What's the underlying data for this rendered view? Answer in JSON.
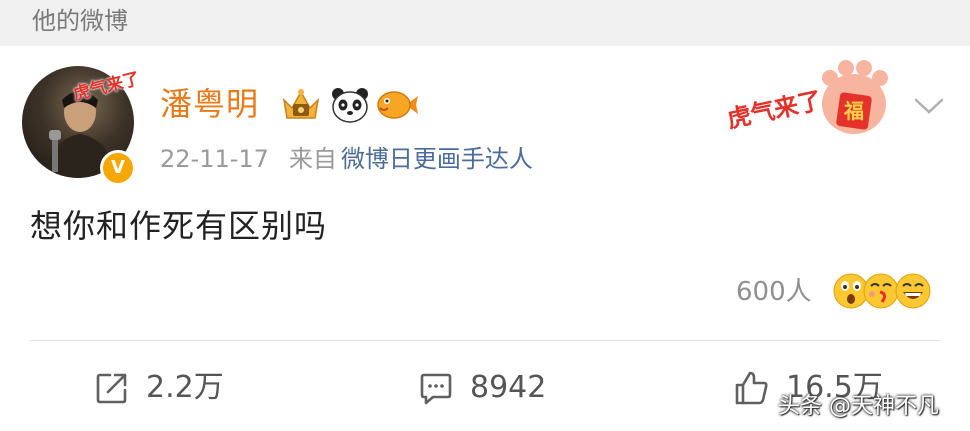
{
  "section": {
    "title": "他的微博"
  },
  "post": {
    "avatar": {
      "overlay_text": "虎气来了",
      "verified_mark": "V"
    },
    "username": "潘粤明",
    "badges": [
      "vip-crown-icon",
      "panda-icon",
      "pufferfish-icon"
    ],
    "date": "22-11-17",
    "from_label": "来自",
    "source": "微博日更画手达人",
    "festival_badge": {
      "text": "虎气来了",
      "stamp": "福"
    },
    "content": "想你和作死有区别吗",
    "reactions": {
      "count_label": "600人",
      "emojis": [
        "surprised-emoji",
        "kiss-emoji",
        "laugh-emoji"
      ]
    },
    "actions": {
      "repost": {
        "icon": "share-icon",
        "count": "2.2万"
      },
      "comment": {
        "icon": "comment-icon",
        "count": "8942"
      },
      "like": {
        "icon": "thumbs-up-icon",
        "count": "16.5万"
      }
    }
  },
  "watermark": "头条 @天神不凡",
  "colors": {
    "username": "#ea7a19",
    "source_link": "#4c6c9a",
    "meta_gray": "#9a9a9a",
    "header_bg": "#f0f0f0",
    "festival_red": "#e4322b",
    "verified": "#f6a800"
  }
}
